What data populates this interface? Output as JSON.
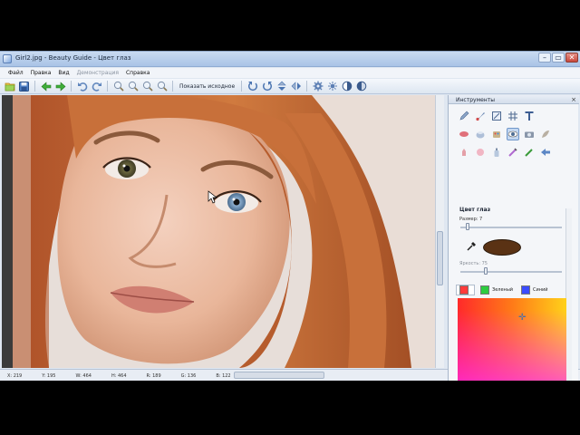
{
  "window": {
    "title": "Girl2.jpg - Beauty Guide - Цвет глаз",
    "controls": {
      "minimize": "–",
      "maximize": "▭",
      "close": "✕"
    }
  },
  "menu": {
    "items": [
      {
        "label": "Файл",
        "enabled": true
      },
      {
        "label": "Правка",
        "enabled": true
      },
      {
        "label": "Вид",
        "enabled": true
      },
      {
        "label": "Демонстрация",
        "enabled": false
      },
      {
        "label": "Справка",
        "enabled": true
      }
    ]
  },
  "toolbar": {
    "show_original_label": "Показать исходное"
  },
  "statusbar": {
    "x": "X: 219",
    "y": "Y: 195",
    "w": "W: 464",
    "h": "H: 464",
    "r": "R: 189",
    "g": "G: 136",
    "b": "B: 122"
  },
  "panel": {
    "title": "Инструменты",
    "close": "×",
    "section_title": "Цвет глаз",
    "size_label": "Размер: 7",
    "size_value": 7,
    "brightness_label": "Яркость: 75",
    "brightness_value": 75,
    "swatch_color": "#5a3214",
    "tabs": [
      {
        "label": "",
        "chip_color": "#ff3b3b"
      },
      {
        "label": "Зеленый",
        "chip_color": "#2ecc40"
      },
      {
        "label": "Синий",
        "chip_color": "#3b4cff"
      }
    ]
  },
  "icons": {
    "app": "app-icon",
    "open": "folder-open-icon",
    "save": "save-icon",
    "back": "arrow-left-icon",
    "forward": "arrow-right-icon",
    "undo": "undo-icon",
    "redo": "redo-icon",
    "zoom_in": "zoom-in-icon",
    "zoom_out": "zoom-out-icon",
    "eyedropper": "eyedropper-icon",
    "picker_cross": "crosshair-icon"
  }
}
